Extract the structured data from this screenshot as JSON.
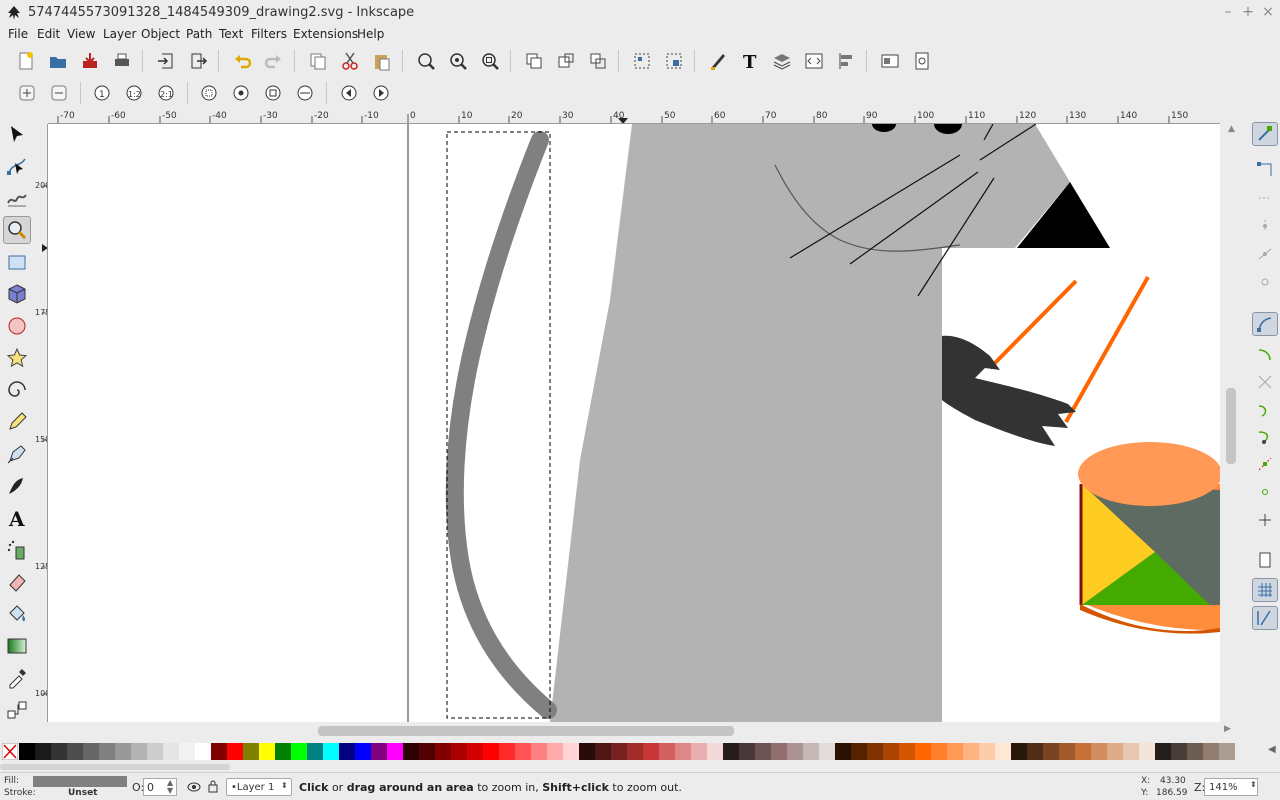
{
  "window": {
    "title": "5747445573091328_1484549309_drawing2.svg - Inkscape"
  },
  "menu": [
    "File",
    "Edit",
    "View",
    "Layer",
    "Object",
    "Path",
    "Text",
    "Filters",
    "Extensions",
    "Help"
  ],
  "ruler": {
    "h_ticks": [
      "-70",
      "-60",
      "-50",
      "-40",
      "-30",
      "-20",
      "-10",
      "0",
      "10",
      "20",
      "30",
      "40",
      "50",
      "60",
      "70",
      "80",
      "90",
      "100",
      "110",
      "120",
      "130",
      "140",
      "150"
    ],
    "v_ticks": [
      "200",
      "175",
      "150",
      "125",
      "100"
    ]
  },
  "status": {
    "fill_label": "Fill:",
    "stroke_label": "Stroke:",
    "stroke_value": "Unset",
    "opacity_label": "O:",
    "opacity_value": "0",
    "layer": "•Layer 1",
    "msg_b1": "Click",
    "msg_t1": " or ",
    "msg_b2": "drag around an area",
    "msg_t2": " to zoom in, ",
    "msg_b3": "Shift+click",
    "msg_t3": " to zoom out.",
    "x_label": "X:",
    "x_value": "43.30",
    "y_label": "Y:",
    "y_value": "186.59",
    "zoom_label": "Z:",
    "zoom_value": "141%"
  },
  "colors": {
    "selection_dash": "#000000",
    "accent": "#3a6ea5"
  }
}
